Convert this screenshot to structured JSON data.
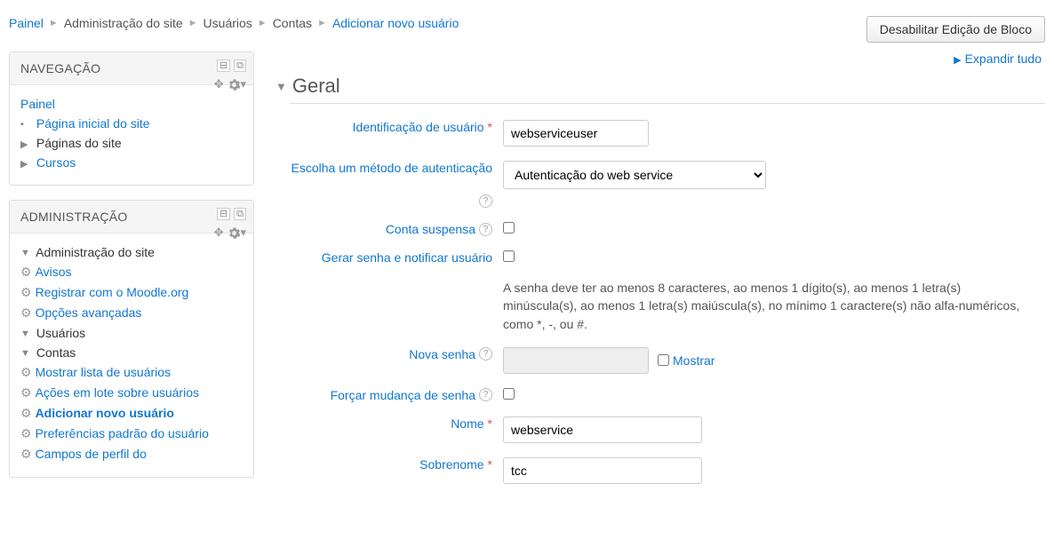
{
  "breadcrumb": {
    "items": [
      {
        "label": "Painel",
        "link": true
      },
      {
        "label": "Administração do site",
        "link": false
      },
      {
        "label": "Usuários",
        "link": false
      },
      {
        "label": "Contas",
        "link": false
      },
      {
        "label": "Adicionar novo usuário",
        "link": true
      }
    ]
  },
  "buttons": {
    "disable_block_edit": "Desabilitar Edição de Bloco"
  },
  "nav_block": {
    "title": "NAVEGAÇÃO",
    "items": {
      "painel": "Painel",
      "pagina_inicial": "Página inicial do site",
      "paginas_site": "Páginas do site",
      "cursos": "Cursos"
    }
  },
  "admin_block": {
    "title": "ADMINISTRAÇÃO",
    "root": "Administração do site",
    "avisos": "Avisos",
    "registrar": "Registrar com o Moodle.org",
    "opcoes": "Opções avançadas",
    "usuarios": "Usuários",
    "contas": "Contas",
    "mostrar_lista": "Mostrar lista de usuários",
    "acoes_lote": "Ações em lote sobre usuários",
    "adicionar_novo": "Adicionar novo usuário",
    "preferencias": "Preferências padrão do usuário",
    "campos_perfil": "Campos de perfil do"
  },
  "main": {
    "expand_all": "Expandir tudo",
    "section_geral": "Geral"
  },
  "form": {
    "username_label": "Identificação de usuário",
    "username_value": "webserviceuser",
    "auth_label": "Escolha um método de autenticação",
    "auth_value": "Autenticação do web service",
    "suspended_label": "Conta suspensa",
    "genpass_label": "Gerar senha e notificar usuário",
    "password_hint": "A senha deve ter ao menos 8 caracteres, ao menos 1 dígito(s), ao menos 1 letra(s) minúscula(s), ao menos 1 letra(s) maiúscula(s), no mínimo 1 caractere(s) não alfa-numéricos, como *, -, ou #.",
    "newpass_label": "Nova senha",
    "show_label": "Mostrar",
    "forcepass_label": "Forçar mudança de senha",
    "firstname_label": "Nome",
    "firstname_value": "webservice",
    "lastname_label": "Sobrenome",
    "lastname_value": "tcc"
  }
}
